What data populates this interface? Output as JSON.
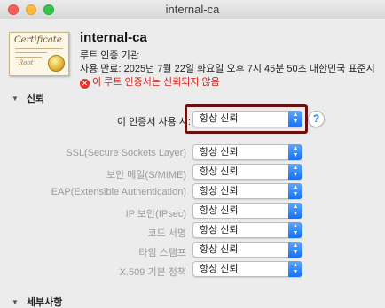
{
  "window": {
    "title": "internal-ca"
  },
  "certificate": {
    "icon_title": "Certificate",
    "icon_subtitle": "Root",
    "name": "internal-ca",
    "kind": "루트 인증 기관",
    "expiry": "사용 만료: 2025년 7월 22일 화요일 오후 7시 45분 50초 대한민국 표준시",
    "warning": "이 루트 인증서는 신뢰되지 않음",
    "warning_icon": "✕"
  },
  "trust": {
    "section_label": "신뢰",
    "main_label": "이 인증서 사용 시:",
    "main_value": "항상 신뢰",
    "help": "?",
    "rows": [
      {
        "label": "SSL(Secure Sockets Layer)",
        "value": "항상 신뢰"
      },
      {
        "label": "보안 메일(S/MIME)",
        "value": "항상 신뢰"
      },
      {
        "label": "EAP(Extensible Authentication)",
        "value": "항상 신뢰"
      },
      {
        "label": "IP 보안(IPsec)",
        "value": "항상 신뢰"
      },
      {
        "label": "코드 서명",
        "value": "항상 신뢰"
      },
      {
        "label": "타임 스탬프",
        "value": "항상 신뢰"
      },
      {
        "label": "X.509 기본 정책",
        "value": "항상 신뢰"
      }
    ]
  },
  "details": {
    "section_label": "세부사항"
  },
  "colors": {
    "accent": "#1570f6",
    "warning": "#d0211b",
    "highlight": "#6b0f0f"
  },
  "icons": {
    "close": "close-button-icon",
    "minimize": "minimize-button-icon",
    "maximize": "maximize-button-icon",
    "disclosure": "disclosure-triangle-icon",
    "popup_arrows": "up-down-chevron-icon",
    "warning": "error-circle-icon"
  }
}
